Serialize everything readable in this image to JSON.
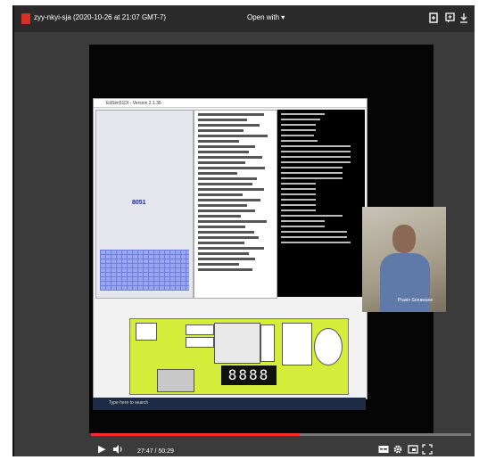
{
  "viewer": {
    "file_title": "zyy-nkyi-sja (2020-10-26 at 21:07 GMT-7)",
    "open_with_label": "Open with"
  },
  "icons": {
    "pdf": "pdf-icon",
    "add_to_drive": "add-to-drive-icon",
    "comment": "comment-icon",
    "download": "download-icon",
    "more": "more-vertical-icon"
  },
  "simulator": {
    "window_title": "EdSim51DI - Version 2.1.35",
    "brand_label": "8051",
    "seven_segment_readout": "8888",
    "taskbar_search_placeholder": "Type here to search"
  },
  "presenter": {
    "name_tag": "Pravin Sonawane"
  },
  "player": {
    "current_time": "27:47",
    "duration": "50:29",
    "time_separator": " / ",
    "progress_fraction": 0.55
  },
  "colors": {
    "progress_fill": "#ff2c2c",
    "board": "#d4ed3a",
    "pdf_icon": "#d93025"
  }
}
